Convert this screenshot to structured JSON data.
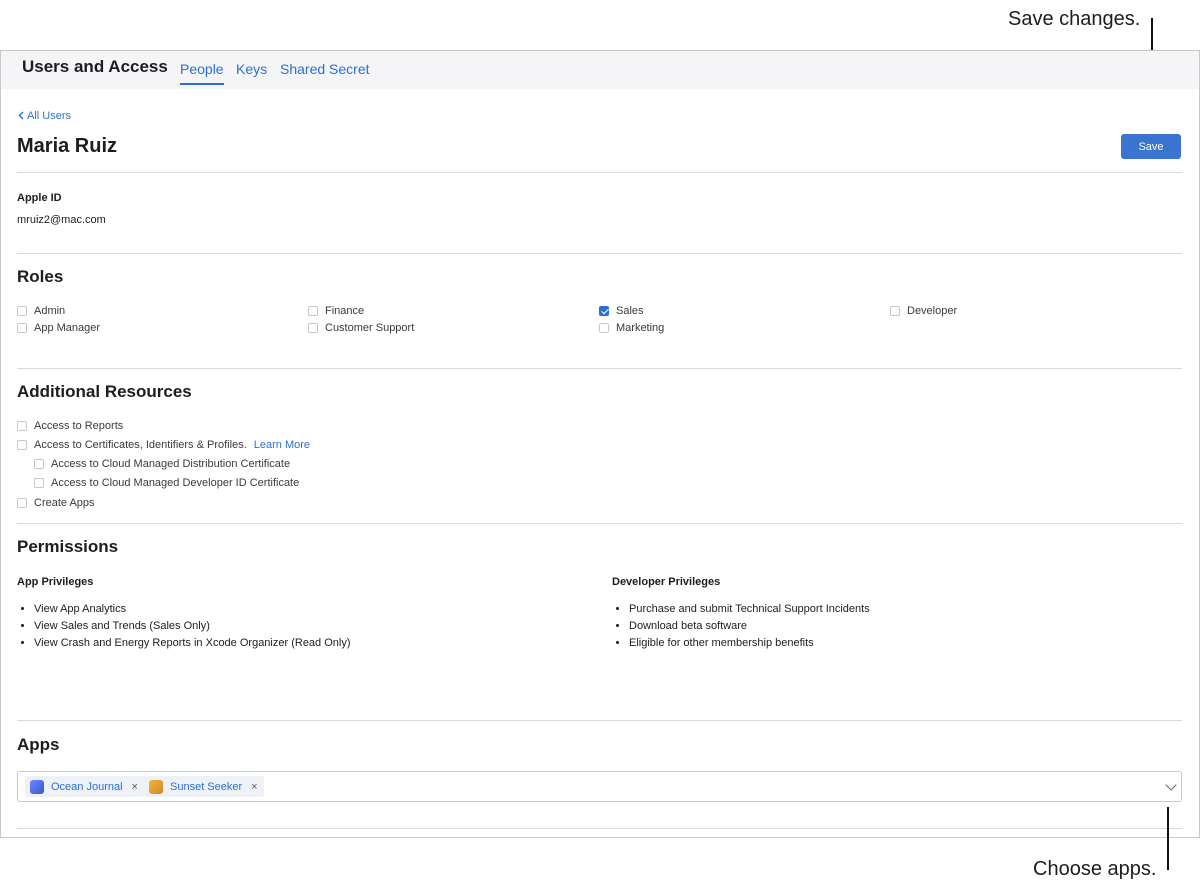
{
  "callouts": {
    "save": "Save changes.",
    "apps": "Choose apps."
  },
  "header": {
    "title": "Users and Access",
    "tabs": [
      {
        "label": "People",
        "active": true
      },
      {
        "label": "Keys",
        "active": false
      },
      {
        "label": "Shared Secret",
        "active": false
      }
    ]
  },
  "back_link": "All Users",
  "user": {
    "name": "Maria Ruiz",
    "apple_id_label": "Apple ID",
    "apple_id": "mruiz2@mac.com"
  },
  "save_label": "Save",
  "roles": {
    "title": "Roles",
    "items": [
      {
        "label": "Admin",
        "checked": false
      },
      {
        "label": "App Manager",
        "checked": false
      },
      {
        "label": "Finance",
        "checked": false
      },
      {
        "label": "Customer Support",
        "checked": false
      },
      {
        "label": "Sales",
        "checked": true
      },
      {
        "label": "Marketing",
        "checked": false
      },
      {
        "label": "Developer",
        "checked": false
      }
    ]
  },
  "resources": {
    "title": "Additional Resources",
    "items": [
      {
        "label": "Access to Reports"
      },
      {
        "label": "Access to Certificates, Identifiers & Profiles.",
        "link": "Learn More"
      },
      {
        "label": "Access to Cloud Managed Distribution Certificate"
      },
      {
        "label": "Access to Cloud Managed Developer ID Certificate"
      },
      {
        "label": "Create Apps"
      }
    ]
  },
  "permissions": {
    "title": "Permissions",
    "app": {
      "title": "App Privileges",
      "items": [
        "View App Analytics",
        "View Sales and Trends (Sales Only)",
        "View Crash and Energy Reports in Xcode Organizer (Read Only)"
      ]
    },
    "developer": {
      "title": "Developer Privileges",
      "items": [
        "Purchase and submit Technical Support Incidents",
        "Download beta software",
        "Eligible for other membership benefits"
      ]
    }
  },
  "apps": {
    "title": "Apps",
    "selected": [
      {
        "name": "Ocean Journal",
        "icon": "ocean-journal-app-icon",
        "color": "#4a6fe0"
      },
      {
        "name": "Sunset Seeker",
        "icon": "sunset-seeker-app-icon",
        "color": "#e0a030"
      }
    ],
    "remove_glyph": "×"
  }
}
